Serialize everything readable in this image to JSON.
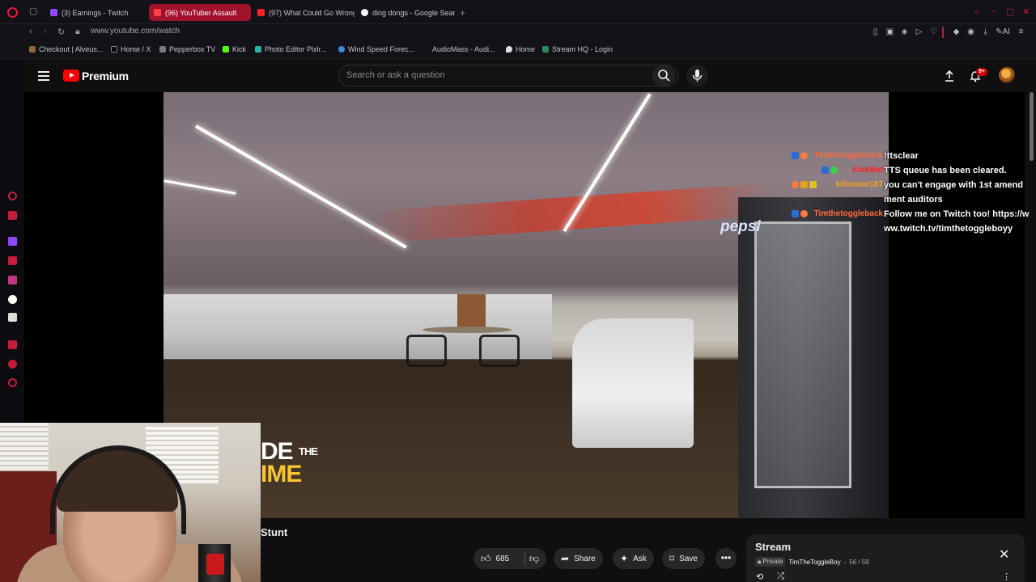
{
  "colors": {
    "accent": "#e8183a",
    "active_tab": "#a3122c",
    "youtube_red": "#ff0000",
    "twitch_purple": "#9146ff"
  },
  "browser": {
    "tabs": [
      {
        "label": "(3) Earnings - Twitch",
        "icon": "twitch-icon",
        "active": false
      },
      {
        "label": "(96) YouTuber Assault",
        "icon": "youtube-icon",
        "active": true
      },
      {
        "label": "(97) What Could Go Wrong",
        "icon": "youtube-icon",
        "active": false
      },
      {
        "label": "ding dongs - Google Search",
        "icon": "google-icon",
        "active": false
      }
    ],
    "url": "www.youtube.com/watch",
    "bookmarks": [
      {
        "label": "Checkout | Alveus...",
        "icon": "bookmark-icon"
      },
      {
        "label": "Home / X",
        "icon": "x-icon"
      },
      {
        "label": "Pepperbox TV",
        "icon": "pepperbox-icon"
      },
      {
        "label": "Kick",
        "icon": "kick-icon"
      },
      {
        "label": "Photo Editor Pixlr...",
        "icon": "pixlr-icon"
      },
      {
        "label": "Wind Speed Forec...",
        "icon": "wind-icon"
      },
      {
        "label": "AudioMass - Audi...",
        "icon": "audiomass-icon"
      },
      {
        "label": "Home",
        "icon": "location-icon"
      },
      {
        "label": "Stream HQ - Login",
        "icon": "streamhq-icon"
      }
    ]
  },
  "youtube": {
    "logo_text": "Premium",
    "search_placeholder": "Search or ask a question",
    "notification_badge": "9+"
  },
  "video": {
    "caption_line1": "DE",
    "caption_small": "THE",
    "caption_line2": "IME",
    "title": "Stunt",
    "pepsi_text": "pepsi",
    "likes": "685",
    "share_label": "Share",
    "ask_label": "Ask",
    "save_label": "Save"
  },
  "chat": [
    {
      "user": "Timthetoggleback",
      "user_color": "#ff6a3d",
      "msg": "!ttsclear"
    },
    {
      "user": "KickBot",
      "user_color": "#ff2020",
      "msg": "TTS queue has been cleared."
    },
    {
      "user": "killinator187",
      "user_color": "#f0a020",
      "msg": "you can't engage with 1st amendment auditors"
    },
    {
      "user": "Timthetoggleback",
      "user_color": "#ff6a3d",
      "msg": "Follow me on Twitch too! https://www.twitch.tv/timthetoggleboyy"
    }
  ],
  "playlist": {
    "title": "Stream",
    "privacy": "Private",
    "owner": "TimTheToggleBoy",
    "position": "56 / 59"
  }
}
